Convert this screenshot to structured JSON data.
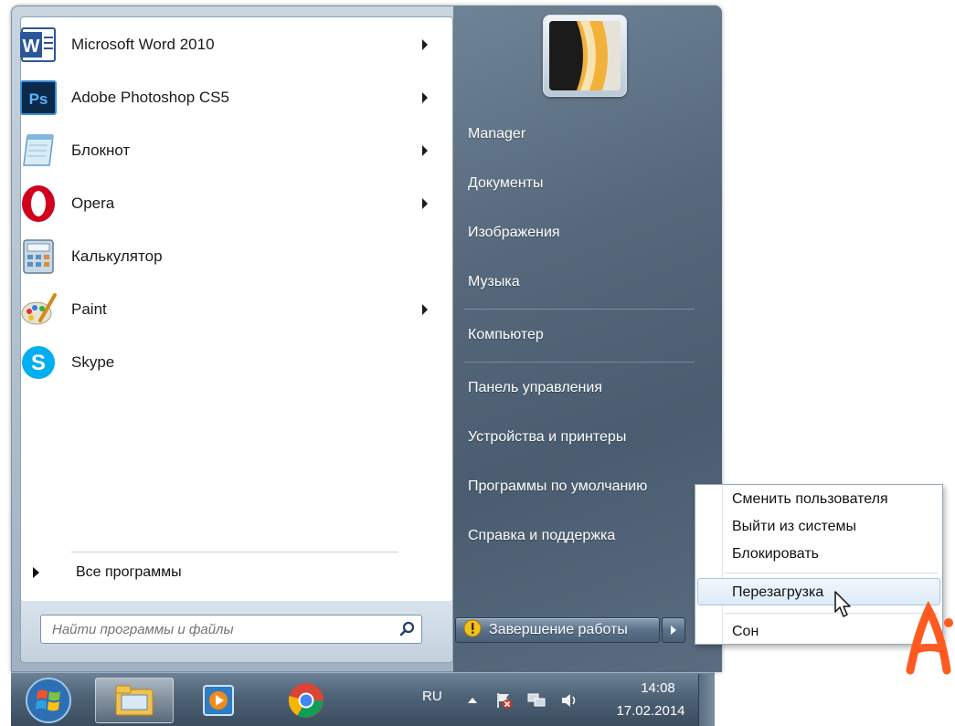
{
  "programs": [
    {
      "label": "Microsoft Word 2010",
      "icon": "word-icon",
      "has_submenu": true
    },
    {
      "label": "Adobe Photoshop CS5",
      "icon": "photoshop-icon",
      "has_submenu": true
    },
    {
      "label": "Блокнот",
      "icon": "notepad-icon",
      "has_submenu": true
    },
    {
      "label": "Opera",
      "icon": "opera-icon",
      "has_submenu": true
    },
    {
      "label": "Калькулятор",
      "icon": "calculator-icon",
      "has_submenu": false
    },
    {
      "label": "Paint",
      "icon": "paint-icon",
      "has_submenu": true
    },
    {
      "label": "Skype",
      "icon": "skype-icon",
      "has_submenu": false
    }
  ],
  "all_programs": "Все программы",
  "search": {
    "placeholder": "Найти программы и файлы",
    "value": ""
  },
  "right_menu": [
    "Manager",
    "Документы",
    "Изображения",
    "Музыка",
    "Компьютер",
    "Панель управления",
    "Устройства и принтеры",
    "Программы по умолчанию",
    "Справка и поддержка"
  ],
  "shutdown": {
    "label": "Завершение работы"
  },
  "submenu": {
    "items": [
      "Сменить пользователя",
      "Выйти из системы",
      "Блокировать",
      "Перезагрузка",
      "Сон"
    ],
    "highlighted": "Перезагрузка"
  },
  "taskbar": {
    "apps": [
      "file-explorer-icon",
      "media-player-icon",
      "chrome-icon"
    ],
    "language": "RU",
    "time": "14:08",
    "date": "17.02.2014"
  },
  "colors": {
    "accent": "#ff5a1f",
    "right_pane": "#56697c",
    "taskbar": "#4e6276"
  }
}
